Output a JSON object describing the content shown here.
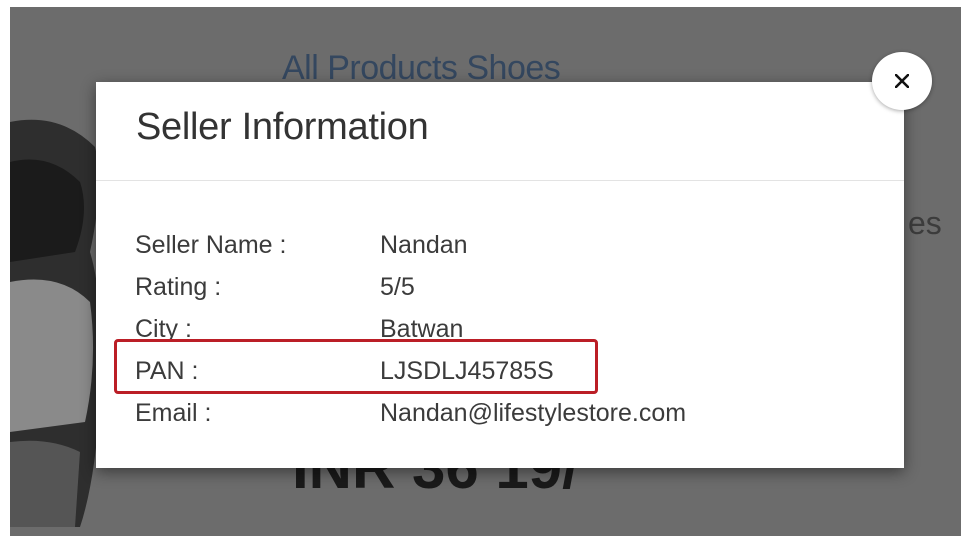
{
  "background": {
    "breadcrumb": "All Products Shoes",
    "side_text": "es",
    "price_text": "INR 36 19/"
  },
  "modal": {
    "title": "Seller Information",
    "close_icon": "close-icon",
    "rows": [
      {
        "label": "Seller Name :",
        "value": "Nandan"
      },
      {
        "label": "Rating :",
        "value": "5/5"
      },
      {
        "label": "City :",
        "value": "Batwan"
      },
      {
        "label": "PAN :",
        "value": "LJSDLJ45785S"
      },
      {
        "label": "Email :",
        "value": "Nandan@lifestylestore.com"
      }
    ],
    "highlighted_row": "PAN :"
  },
  "colors": {
    "overlay": "#6c6c6c",
    "highlight": "#bb1e26",
    "breadcrumb": "#34475f"
  }
}
